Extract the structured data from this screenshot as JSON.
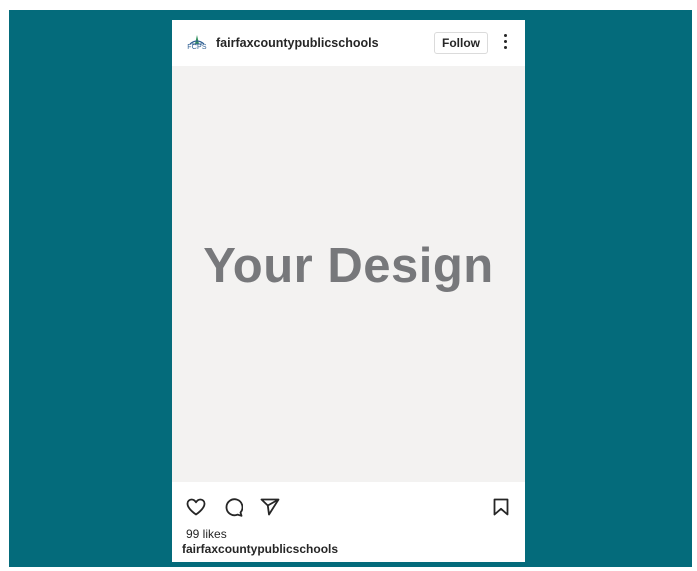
{
  "colors": {
    "page_background": "#046b7b",
    "card_background": "#ffffff",
    "media_background": "#f3f2f1",
    "design_text": "#77787b",
    "primary_text": "#262626"
  },
  "post": {
    "logo_text": "FCPS",
    "username": "fairfaxcountypublicschools",
    "follow_label": "Follow",
    "more_icon": "vertical-ellipsis-icon",
    "media_placeholder": "Your Design",
    "likes": "99 likes",
    "caption_username": "fairfaxcountypublicschools",
    "action_icons": [
      "heart-icon",
      "comment-icon",
      "share-icon",
      "bookmark-icon"
    ]
  }
}
